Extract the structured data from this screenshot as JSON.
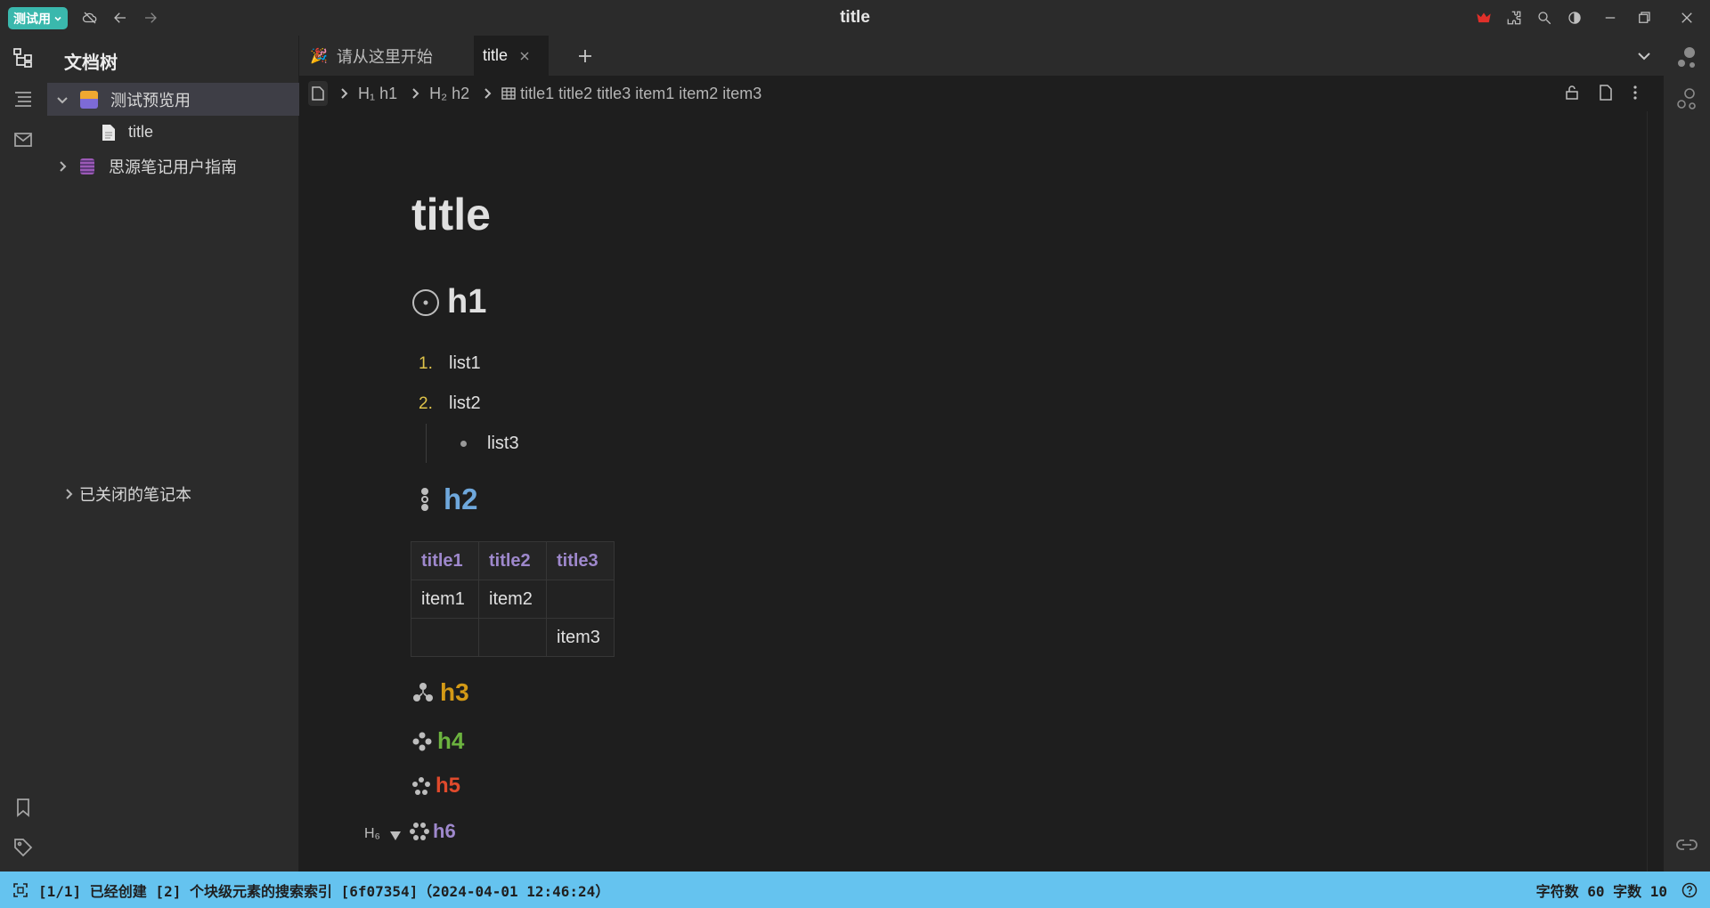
{
  "window": {
    "badge": "测试用",
    "title": "title"
  },
  "tree": {
    "title": "文档树",
    "items": [
      {
        "label": "测试预览用",
        "expanded": true
      },
      {
        "label": "title"
      },
      {
        "label": "思源笔记用户指南",
        "expanded": false
      }
    ],
    "closed_notebooks": "已关闭的笔记本"
  },
  "tabs": [
    {
      "label": "请从这里开始",
      "active": false
    },
    {
      "label": "title",
      "active": true
    }
  ],
  "breadcrumb": [
    {
      "prefix": "H₁",
      "label": "h1"
    },
    {
      "prefix": "H₂",
      "label": "h2"
    },
    {
      "label": "title1 title2 title3 item1 item2 item3"
    }
  ],
  "doc": {
    "title": "title",
    "h1": "h1",
    "list": [
      {
        "marker": "1.",
        "text": "list1"
      },
      {
        "marker": "2.",
        "text": "list2"
      }
    ],
    "sublist": [
      {
        "text": "list3"
      }
    ],
    "h2": "h2",
    "table": {
      "headers": [
        "title1",
        "title2",
        "title3"
      ],
      "rows": [
        [
          "item1",
          "item2",
          ""
        ],
        [
          "",
          "",
          "item3"
        ]
      ]
    },
    "h3": "h3",
    "h4": "h4",
    "h5": "h5",
    "h6": "h6",
    "h6_gutter": "H₆"
  },
  "colors": {
    "h2": "#6fa8dc",
    "h3": "#d49a16",
    "h4": "#6cb33f",
    "h5": "#e04a2c",
    "h6": "#9e88cc",
    "status_bar": "#65c3ef",
    "accent": "#3ab8ad"
  },
  "status": {
    "message": "[1/1] 已经创建 [2] 个块级元素的搜索索引 [6f07354]（2024-04-01 12:46:24）",
    "counts": "字符数 60 字数 10"
  }
}
